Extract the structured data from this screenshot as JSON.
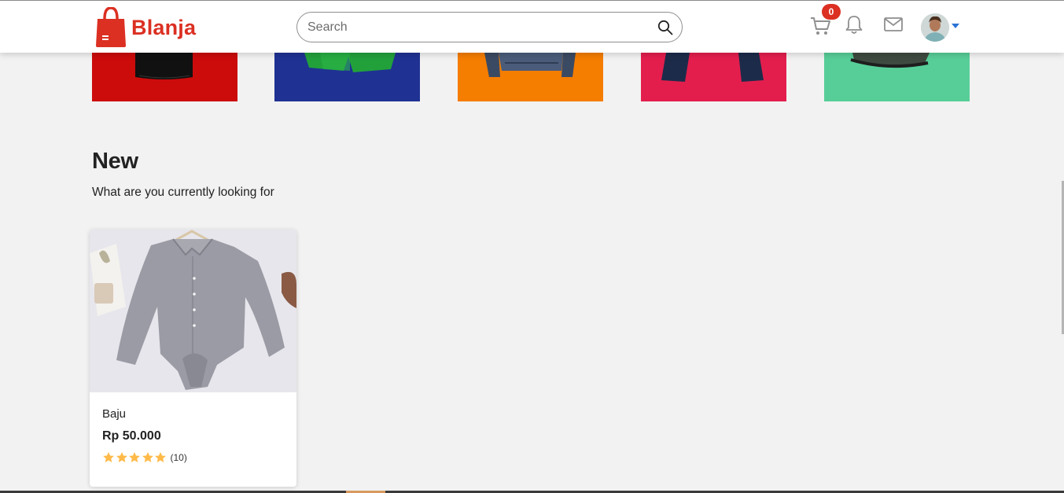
{
  "navbar": {
    "brand": "Blanja",
    "search": {
      "placeholder": "Search",
      "value": ""
    },
    "cart_count": "0",
    "icons": [
      "cart-icon",
      "bell-icon",
      "mail-icon",
      "user-avatar",
      "caret-down-icon"
    ]
  },
  "categories": {
    "tiles": [
      {
        "color": "#cc0b0b",
        "item": "t-shirt"
      },
      {
        "color": "#1f3293",
        "item": "shorts"
      },
      {
        "color": "#f57d00",
        "item": "jacket"
      },
      {
        "color": "#e31e4d",
        "item": "pants"
      },
      {
        "color": "#57ce98",
        "item": "shoes"
      }
    ]
  },
  "new_section": {
    "title": "New",
    "subtitle": "What are you currently looking for"
  },
  "products": [
    {
      "name": "Baju",
      "price": "Rp 50.000",
      "rating_count": "(10)",
      "stars": 5
    }
  ],
  "colors": {
    "brand": "#db3022",
    "star": "#ffba49",
    "background": "#f2f2f2"
  }
}
